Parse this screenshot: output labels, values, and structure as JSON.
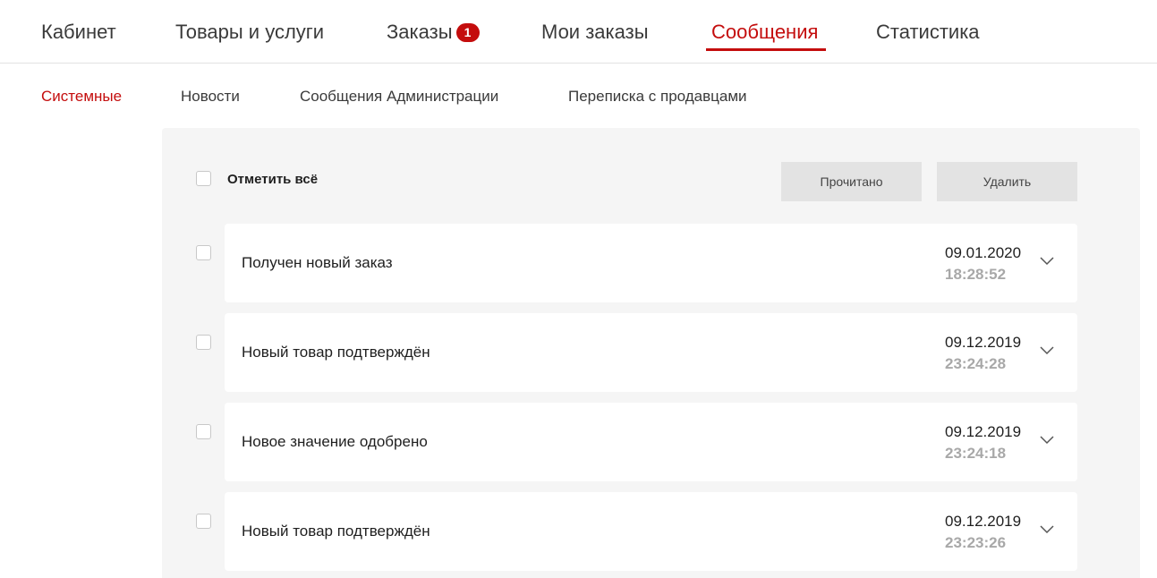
{
  "top_nav": {
    "items": [
      {
        "label": "Кабинет"
      },
      {
        "label": "Товары и услуги"
      },
      {
        "label": "Заказы",
        "badge": "1"
      },
      {
        "label": "Мои заказы"
      },
      {
        "label": "Сообщения",
        "active": true
      },
      {
        "label": "Статистика"
      }
    ]
  },
  "sub_nav": {
    "items": [
      {
        "label": "Системные",
        "active": true
      },
      {
        "label": "Новости"
      },
      {
        "label": "Сообщения Администрации"
      },
      {
        "label": "Переписка с продавцами"
      }
    ]
  },
  "toolbar": {
    "select_all_label": "Отметить всё",
    "read_label": "Прочитано",
    "delete_label": "Удалить"
  },
  "messages": [
    {
      "title": "Получен новый заказ",
      "date": "09.01.2020",
      "time": "18:28:52"
    },
    {
      "title": "Новый товар подтверждён",
      "date": "09.12.2019",
      "time": "23:24:28"
    },
    {
      "title": "Новое значение одобрено",
      "date": "09.12.2019",
      "time": "23:24:18"
    },
    {
      "title": "Новый товар подтверждён",
      "date": "09.12.2019",
      "time": "23:23:26"
    }
  ],
  "colors": {
    "accent": "#c40d0d",
    "panel_background": "#f5f5f5",
    "button_background": "#e3e3e3",
    "time_text": "#a8a8a8"
  },
  "icons": {
    "row_expand": "chevron-down-icon"
  }
}
